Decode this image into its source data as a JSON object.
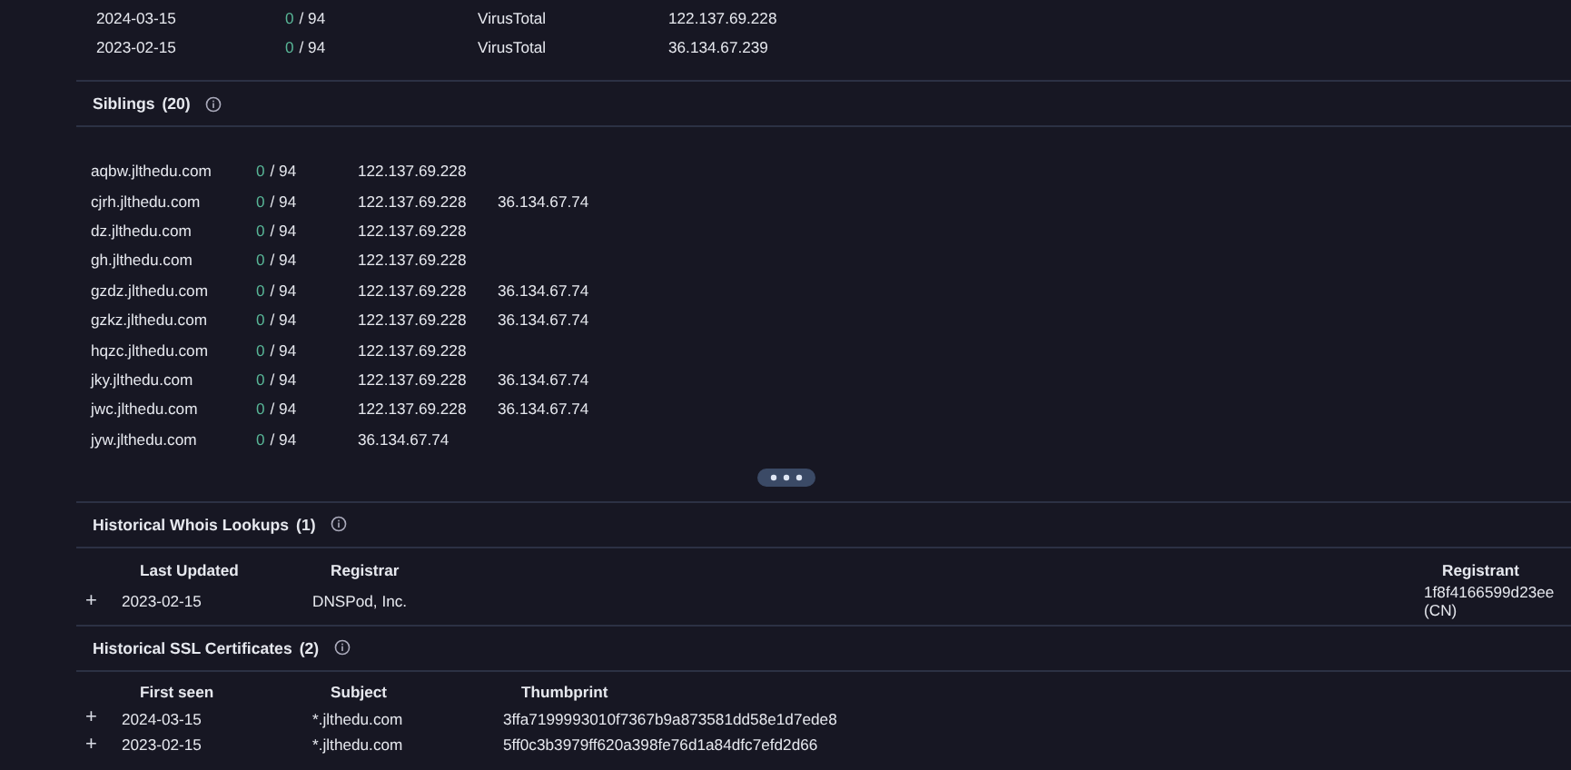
{
  "resolutions": [
    {
      "date": "2024-03-15",
      "positives": "0",
      "ratio": "/ 94",
      "source": "VirusTotal",
      "ip": "122.137.69.228"
    },
    {
      "date": "2023-02-15",
      "positives": "0",
      "ratio": "/ 94",
      "source": "VirusTotal",
      "ip": "36.134.67.239"
    }
  ],
  "siblings": {
    "title": "Siblings",
    "count": "(20)",
    "rows": [
      {
        "domain": "aqbw.jlthedu.com",
        "positives": "0",
        "ratio": "/ 94",
        "ips": [
          "122.137.69.228"
        ]
      },
      {
        "domain": "cjrh.jlthedu.com",
        "positives": "0",
        "ratio": "/ 94",
        "ips": [
          "122.137.69.228",
          "36.134.67.74"
        ]
      },
      {
        "domain": "dz.jlthedu.com",
        "positives": "0",
        "ratio": "/ 94",
        "ips": [
          "122.137.69.228"
        ]
      },
      {
        "domain": "gh.jlthedu.com",
        "positives": "0",
        "ratio": "/ 94",
        "ips": [
          "122.137.69.228"
        ]
      },
      {
        "domain": "gzdz.jlthedu.com",
        "positives": "0",
        "ratio": "/ 94",
        "ips": [
          "122.137.69.228",
          "36.134.67.74"
        ]
      },
      {
        "domain": "gzkz.jlthedu.com",
        "positives": "0",
        "ratio": "/ 94",
        "ips": [
          "122.137.69.228",
          "36.134.67.74"
        ]
      },
      {
        "domain": "hqzc.jlthedu.com",
        "positives": "0",
        "ratio": "/ 94",
        "ips": [
          "122.137.69.228"
        ]
      },
      {
        "domain": "jky.jlthedu.com",
        "positives": "0",
        "ratio": "/ 94",
        "ips": [
          "122.137.69.228",
          "36.134.67.74"
        ]
      },
      {
        "domain": "jwc.jlthedu.com",
        "positives": "0",
        "ratio": "/ 94",
        "ips": [
          "122.137.69.228",
          "36.134.67.74"
        ]
      },
      {
        "domain": "jyw.jlthedu.com",
        "positives": "0",
        "ratio": "/ 94",
        "ips": [
          "36.134.67.74"
        ]
      }
    ]
  },
  "whois": {
    "title": "Historical Whois Lookups",
    "count": "(1)",
    "columns": [
      "Last Updated",
      "Registrar",
      "Registrant"
    ],
    "rows": [
      {
        "expand": "+",
        "cells": [
          "2023-02-15",
          "DNSPod, Inc.",
          "1f8f4166599d23ee (CN)"
        ]
      }
    ]
  },
  "ssl": {
    "title": "Historical SSL Certificates",
    "count": "(2)",
    "columns": [
      "First seen",
      "Subject",
      "Thumbprint"
    ],
    "rows": [
      {
        "expand": "+",
        "cells": [
          "2024-03-15",
          "*.jlthedu.com",
          "3ffa7199993010f7367b9a873581dd58e1d7ede8"
        ]
      },
      {
        "expand": "+",
        "cells": [
          "2023-02-15",
          "*.jlthedu.com",
          "5ff0c3b3979ff620a398fe76d1a84dfc7efd2d66"
        ]
      }
    ]
  }
}
